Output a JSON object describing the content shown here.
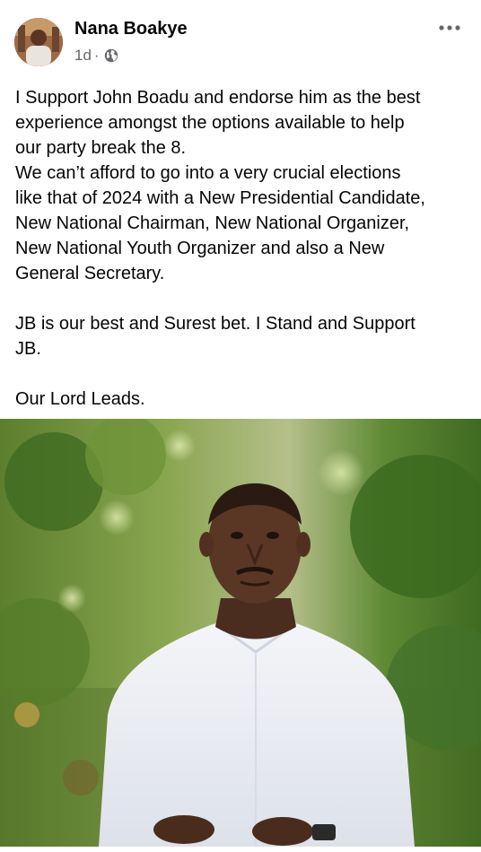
{
  "post": {
    "author": {
      "name": "Nana Boakye",
      "avatar_icon": "profile-photo"
    },
    "meta": {
      "time": "1d",
      "separator": "·",
      "audience_icon": "globe-icon"
    },
    "more_icon": "more-options-icon",
    "text_lines": [
      "I Support John Boadu and endorse him as the best",
      "experience amongst the options available to help",
      "our party break the 8.",
      "We can’t afford to go into a very crucial elections",
      "like that of 2024 with a New Presidential Candidate,",
      "New National Chairman, New National Organizer,",
      "New National Youth Organizer and also a New",
      "General Secretary.",
      "",
      "JB is our best and Surest bet. I Stand and Support",
      "JB.",
      "",
      "Our Lord Leads."
    ],
    "photo": {
      "icon": "portrait-photo"
    }
  },
  "colors": {
    "text": "#050505",
    "secondary_text": "#65676b",
    "background": "#ffffff"
  }
}
